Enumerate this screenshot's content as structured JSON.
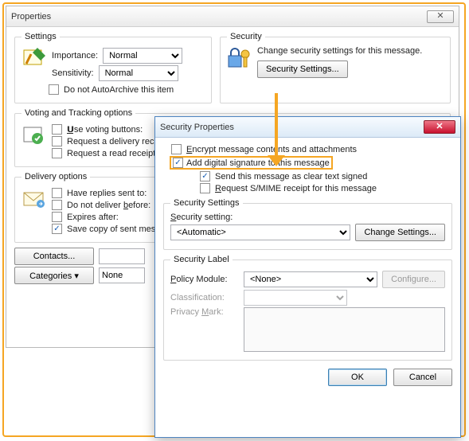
{
  "props": {
    "title": "Properties",
    "closeGlyph": "✕",
    "settings": {
      "legend": "Settings",
      "importanceLabel": "Importance:",
      "importanceValue": "Normal",
      "sensitivityLabel": "Sensitivity:",
      "sensitivityValue": "Normal",
      "autoArchive": "Do not AutoArchive this item"
    },
    "security": {
      "legend": "Security",
      "desc": "Change security settings for this message.",
      "button": "Security Settings..."
    },
    "voting": {
      "legend": "Voting and Tracking options",
      "useVoting": "Use voting buttons:",
      "reqDelivery": "Request a delivery rece",
      "reqRead": "Request a read receipt"
    },
    "delivery": {
      "legend": "Delivery options",
      "haveReplies": "Have replies sent to:",
      "doNotBefore": "Do not deliver before:",
      "expires": "Expires after:",
      "saveCopy": "Save copy of sent mes"
    },
    "contacts": "Contacts...",
    "categories": "Categories ▾",
    "categoriesValue": "None"
  },
  "sec": {
    "title": "Security Properties",
    "closeGlyph": "✕",
    "encrypt": "Encrypt message contents and attachments",
    "sign": "Add digital signature to this message",
    "clearText": "Send this message as clear text signed",
    "smime": "Request S/MIME receipt for this message",
    "settings": {
      "legend": "Security Settings",
      "settingLabel": "Security setting:",
      "settingValue": "<Automatic>",
      "changeBtn": "Change Settings..."
    },
    "label": {
      "legend": "Security Label",
      "policyLabel": "Policy Module:",
      "policyValue": "<None>",
      "configureBtn": "Configure...",
      "classification": "Classification:",
      "privacy": "Privacy Mark:"
    },
    "ok": "OK",
    "cancel": "Cancel"
  }
}
